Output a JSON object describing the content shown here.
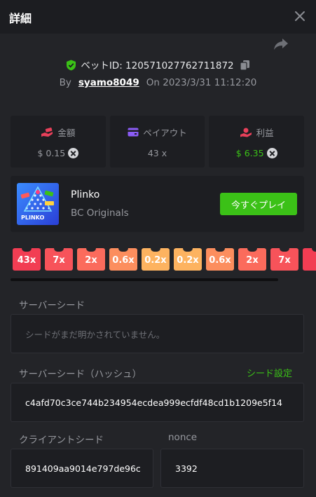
{
  "header": {
    "title": "詳細"
  },
  "bet": {
    "id_label": "ベットID: 120571027762711872",
    "by_label": "By",
    "user": "syamo8049",
    "on_label": "On",
    "datetime": "2023/3/31 11:12:20"
  },
  "stats": {
    "amount": {
      "label": "金額",
      "value": "$ 0.15"
    },
    "payout": {
      "label": "ペイアウト",
      "value": "43 x"
    },
    "profit": {
      "label": "利益",
      "value": "$ 6.35"
    }
  },
  "game": {
    "name": "Plinko",
    "provider": "BC Originals",
    "play_label": "今すぐプレイ",
    "thumb_text": "PLINKO"
  },
  "multipliers": [
    "43x",
    "7x",
    "2x",
    "0.6x",
    "0.2x",
    "0.2x",
    "0.6x",
    "2x",
    "7x"
  ],
  "colors": {
    "chip_colors": [
      "#f23d53",
      "#f7535a",
      "#fb6b5c",
      "#fc8e5e",
      "#fdb360",
      "#fdb360",
      "#fc8e5e",
      "#fb6b5c",
      "#f7535a"
    ],
    "green": "#3bc117"
  },
  "seeds": {
    "server_label": "サーバーシード",
    "server_placeholder": "シードがまだ明かされていません。",
    "hash_label": "サーバーシード（ハッシュ）",
    "seed_settings": "シード設定",
    "hash_value": "c4afd70c3ce744b234954ecdea999ecfdf48cd1b1209e5f14",
    "client_label": "クライアントシード",
    "client_value": "891409aa9014e797de96c",
    "nonce_label": "nonce",
    "nonce_value": "3392"
  }
}
